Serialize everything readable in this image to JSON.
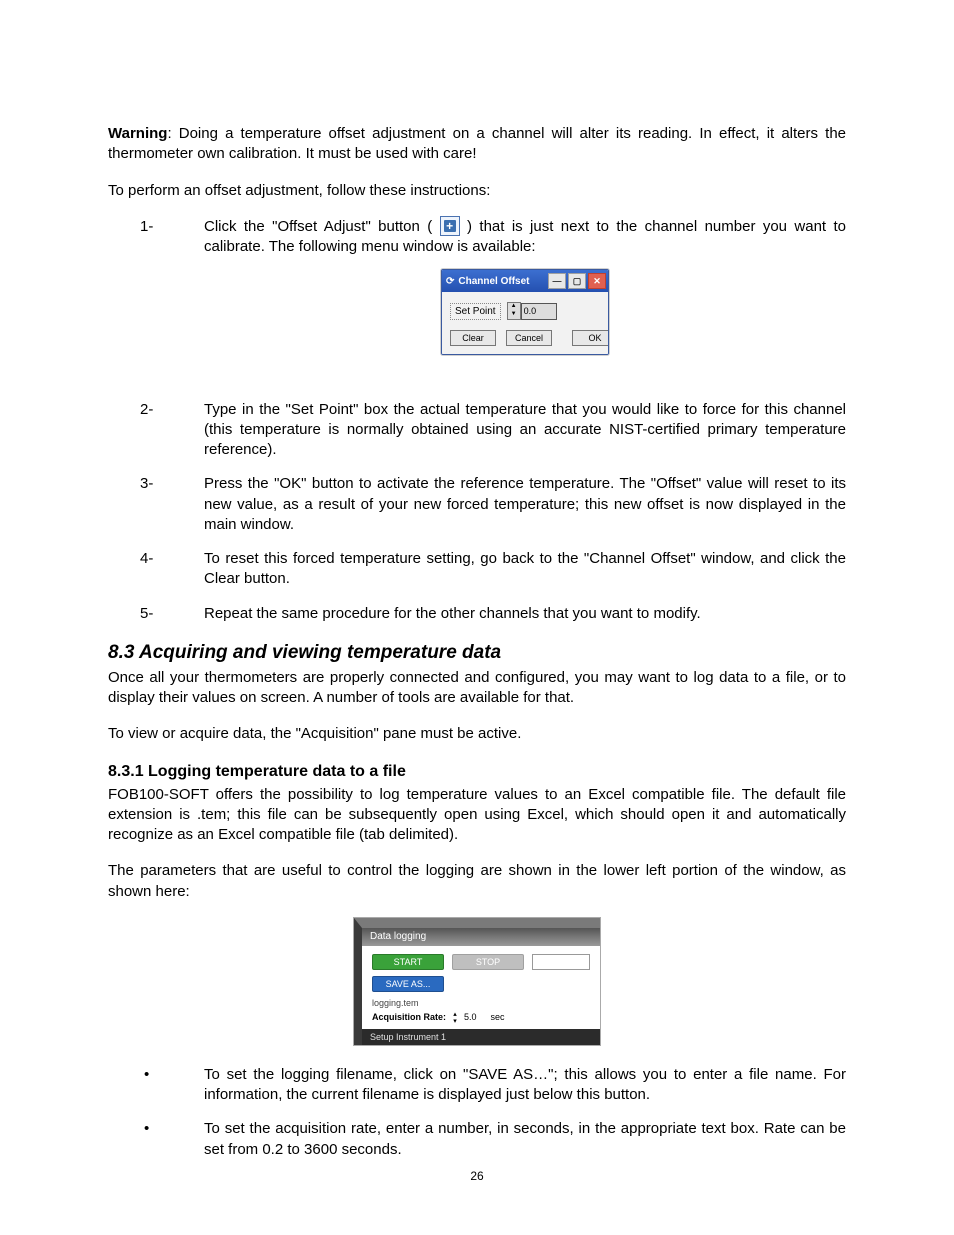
{
  "warning_label": "Warning",
  "warning_text": ": Doing a temperature offset adjustment on a channel will alter its reading. In effect, it alters the thermometer own calibration. It must be used with care!",
  "intro_text": "To perform an offset adjustment, follow these instructions:",
  "steps": {
    "n1": "1-",
    "s1a": "Click the \"Offset Adjust\" button ( ",
    "s1b": " ) that is just next to the channel number you want to calibrate. The following menu window is available:",
    "n2": "2-",
    "s2": "Type in the \"Set Point\" box the actual temperature that you would like to force for this channel (this temperature is normally obtained using an accurate NIST-certified primary temperature reference).",
    "n3": "3-",
    "s3": "Press the \"OK\" button to activate the reference temperature. The \"Offset\" value will reset to its new value, as a result of your new forced temperature; this new offset is now displayed in the main window.",
    "n4": "4-",
    "s4": "To reset this forced temperature setting, go back to the \"Channel Offset\" window, and click the Clear button.",
    "n5": "5-",
    "s5": "Repeat the same procedure for the other channels that you want to modify."
  },
  "dialog1": {
    "title": "Channel Offset",
    "set_point_label": "Set Point",
    "set_point_value": "0.0",
    "clear": "Clear",
    "cancel": "Cancel",
    "ok": "OK"
  },
  "sect_title": "8.3   Acquiring and viewing temperature data",
  "sect_p1": "Once all your thermometers are properly connected and configured, you may want to log data to a file, or to display their values on screen. A number of tools are available for that.",
  "sect_p2": "To view or acquire data, the \"Acquisition\" pane must be active.",
  "subsect_title": "8.3.1   Logging temperature data to a file",
  "sub_p1": "FOB100-SOFT offers the possibility to log temperature values to an Excel compatible file. The default file extension is .tem; this file can be subsequently open using Excel, which should open it and automatically recognize as an Excel compatible file (tab delimited).",
  "sub_p2": "The parameters that are useful to control the logging are shown in the lower left portion of the window, as shown here:",
  "logpanel": {
    "header": "Data logging",
    "start": "START",
    "stop": "STOP",
    "saveas": "SAVE AS...",
    "filename": "logging.tem",
    "rate_label": "Acquisition Rate:",
    "rate_value": "5.0",
    "rate_unit": "sec",
    "footer": "Setup Instrument 1"
  },
  "bullets": {
    "b1": "To set the logging filename, click on \"SAVE AS…\"; this allows you to enter a file name. For information, the current filename is displayed just below this button.",
    "b2": "To set the acquisition rate, enter a number, in seconds, in the appropriate text box. Rate can be set from 0.2 to 3600 seconds."
  },
  "page_number": "26"
}
